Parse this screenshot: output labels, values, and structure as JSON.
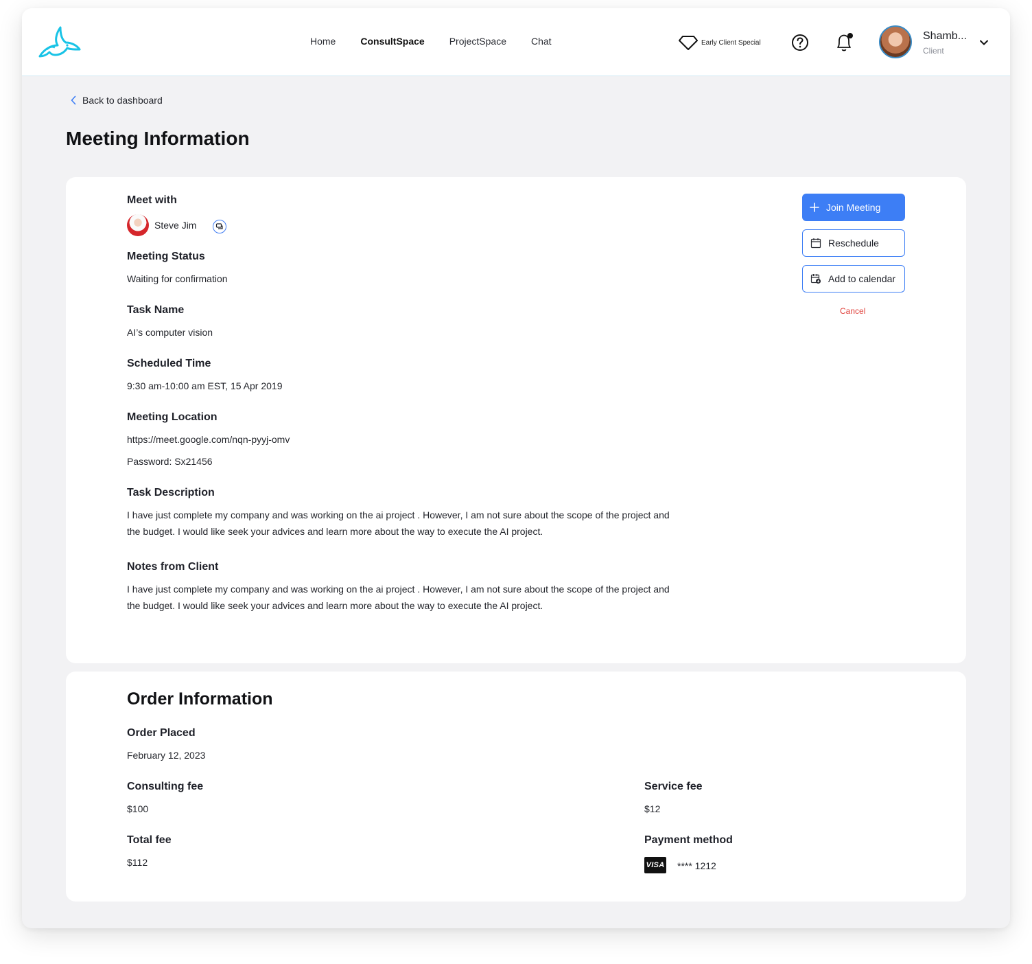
{
  "header": {
    "nav": [
      "Home",
      "ConsultSpace",
      "ProjectSpace",
      "Chat"
    ],
    "active_nav": "ConsultSpace",
    "special_label": "Early Client Special",
    "user_name": "Shamb...",
    "user_role": "Client"
  },
  "back_label": "Back to dashboard",
  "page_title": "Meeting Information",
  "meeting": {
    "meet_with_label": "Meet with",
    "meet_with_name": "Steve Jim",
    "status_label": "Meeting Status",
    "status_value": "Waiting for confirmation",
    "task_name_label": "Task Name",
    "task_name_value": "AI’s computer vision",
    "time_label": "Scheduled Time",
    "time_value": "9:30 am-10:00 am EST, 15 Apr 2019",
    "location_label": "Meeting Location",
    "location_url": "https://meet.google.com/nqn-pyyj-omv",
    "location_password": "Password: Sx21456",
    "description_label": "Task Description",
    "description_line1": "I have just complete my company and was working on the ai project . However, I am not sure about the scope of the project and",
    "description_line2": "the budget.  I would like seek your advices and learn more about the way to execute the AI project.",
    "notes_label": "Notes from Client",
    "notes_line1": "I have just complete my company and was working on the ai project . However, I am not sure about the scope of the project and",
    "notes_line2": "the budget.  I would like seek your advices and learn more about the way to execute the AI project."
  },
  "actions": {
    "join": "Join Meeting",
    "reschedule": "Reschedule",
    "add_calendar": "Add to calendar",
    "cancel": "Cancel"
  },
  "order": {
    "title": "Order Information",
    "placed_label": "Order Placed",
    "placed_value": "February 12, 2023",
    "consulting_label": "Consulting fee",
    "consulting_value": "$100",
    "service_label": "Service fee",
    "service_value": "$12",
    "total_label": "Total fee",
    "total_value": "$112",
    "payment_label": "Payment method",
    "card_brand": "VISA",
    "card_number": "**** 1212"
  },
  "colors": {
    "accent": "#3d7ef5",
    "cancel": "#e0403a",
    "logo": "#19c3e6",
    "background": "#f2f2f4"
  }
}
